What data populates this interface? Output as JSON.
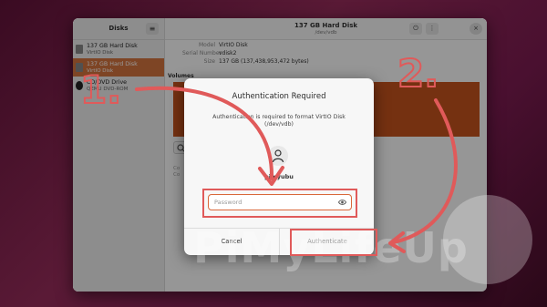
{
  "sidebar": {
    "title": "Disks",
    "menu_icon": "hamburger-menu-icon",
    "items": [
      {
        "name": "137 GB Hard Disk",
        "sub": "VirtIO Disk",
        "selected": false
      },
      {
        "name": "137 GB Hard Disk",
        "sub": "VirtIO Disk",
        "selected": true
      },
      {
        "name": "CD/DVD Drive",
        "sub": "QEMU DVD-ROM",
        "selected": false
      }
    ]
  },
  "header": {
    "title": "137 GB Hard Disk",
    "subtitle": "/dev/vdb",
    "power_icon": "power-icon",
    "kebab_icon": "kebab-menu-icon",
    "kebab_glyph": "⋮",
    "close_glyph": "×"
  },
  "disk_info": {
    "model_label": "Model",
    "model_value": "VirtIO Disk",
    "serial_label": "Serial Number",
    "serial_value": "vdisk2",
    "size_label": "Size",
    "size_value": "137 GB (137,438,953,472 bytes)",
    "volumes_label": "Volumes"
  },
  "background_content": {
    "line1": "Co",
    "line2": "Co"
  },
  "dialog": {
    "title": "Authentication Required",
    "message": "Authentication is required to format VirtIO Disk (/dev/vdb)",
    "user_name": "pimyubu",
    "password_placeholder": "Password",
    "cancel_label": "Cancel",
    "authenticate_label": "Authenticate"
  },
  "annotations": {
    "step1": "1.",
    "step2": "2.",
    "highlight_color": "#e05a5a"
  },
  "watermark": {
    "text": "PiMyLifeUp"
  },
  "colors": {
    "accent": "#c4531d",
    "selected": "#d2733f"
  }
}
